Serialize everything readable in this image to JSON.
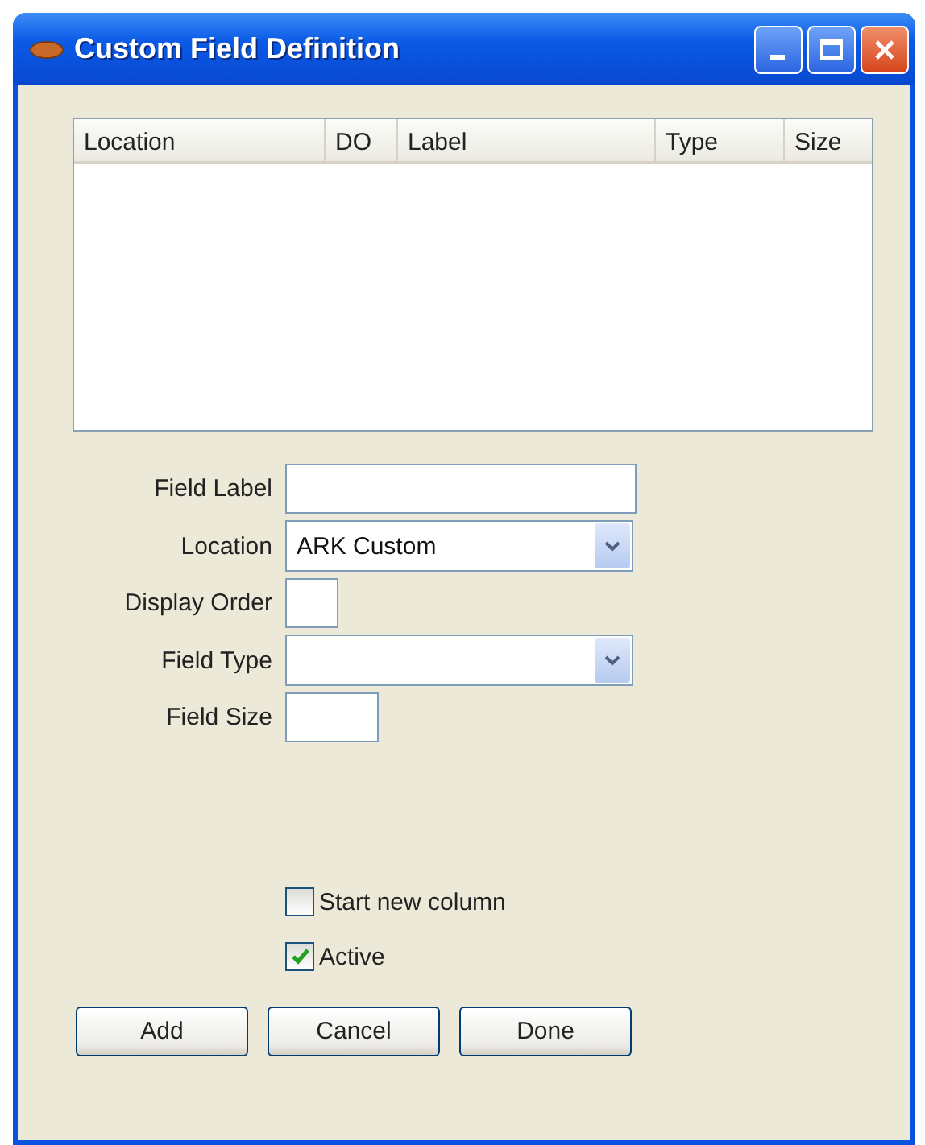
{
  "window": {
    "title": "Custom Field Definition"
  },
  "table": {
    "columns": [
      "Location",
      "DO",
      "Label",
      "Type",
      "Size"
    ]
  },
  "fields": [
    {
      "label": "Field Label",
      "kind": "text"
    },
    {
      "label": "Location",
      "kind": "dropdown",
      "value": "ARK Custom"
    },
    {
      "label": "Display Order",
      "kind": "text"
    },
    {
      "label": "Field Type",
      "kind": "dropdown"
    },
    {
      "label": "Field Size",
      "kind": "text"
    }
  ],
  "checkboxes": [
    {
      "label": "Start new column",
      "checked": false
    },
    {
      "label": "Active",
      "checked": true
    }
  ],
  "buttons": [
    "Add",
    "Cancel",
    "Done"
  ]
}
